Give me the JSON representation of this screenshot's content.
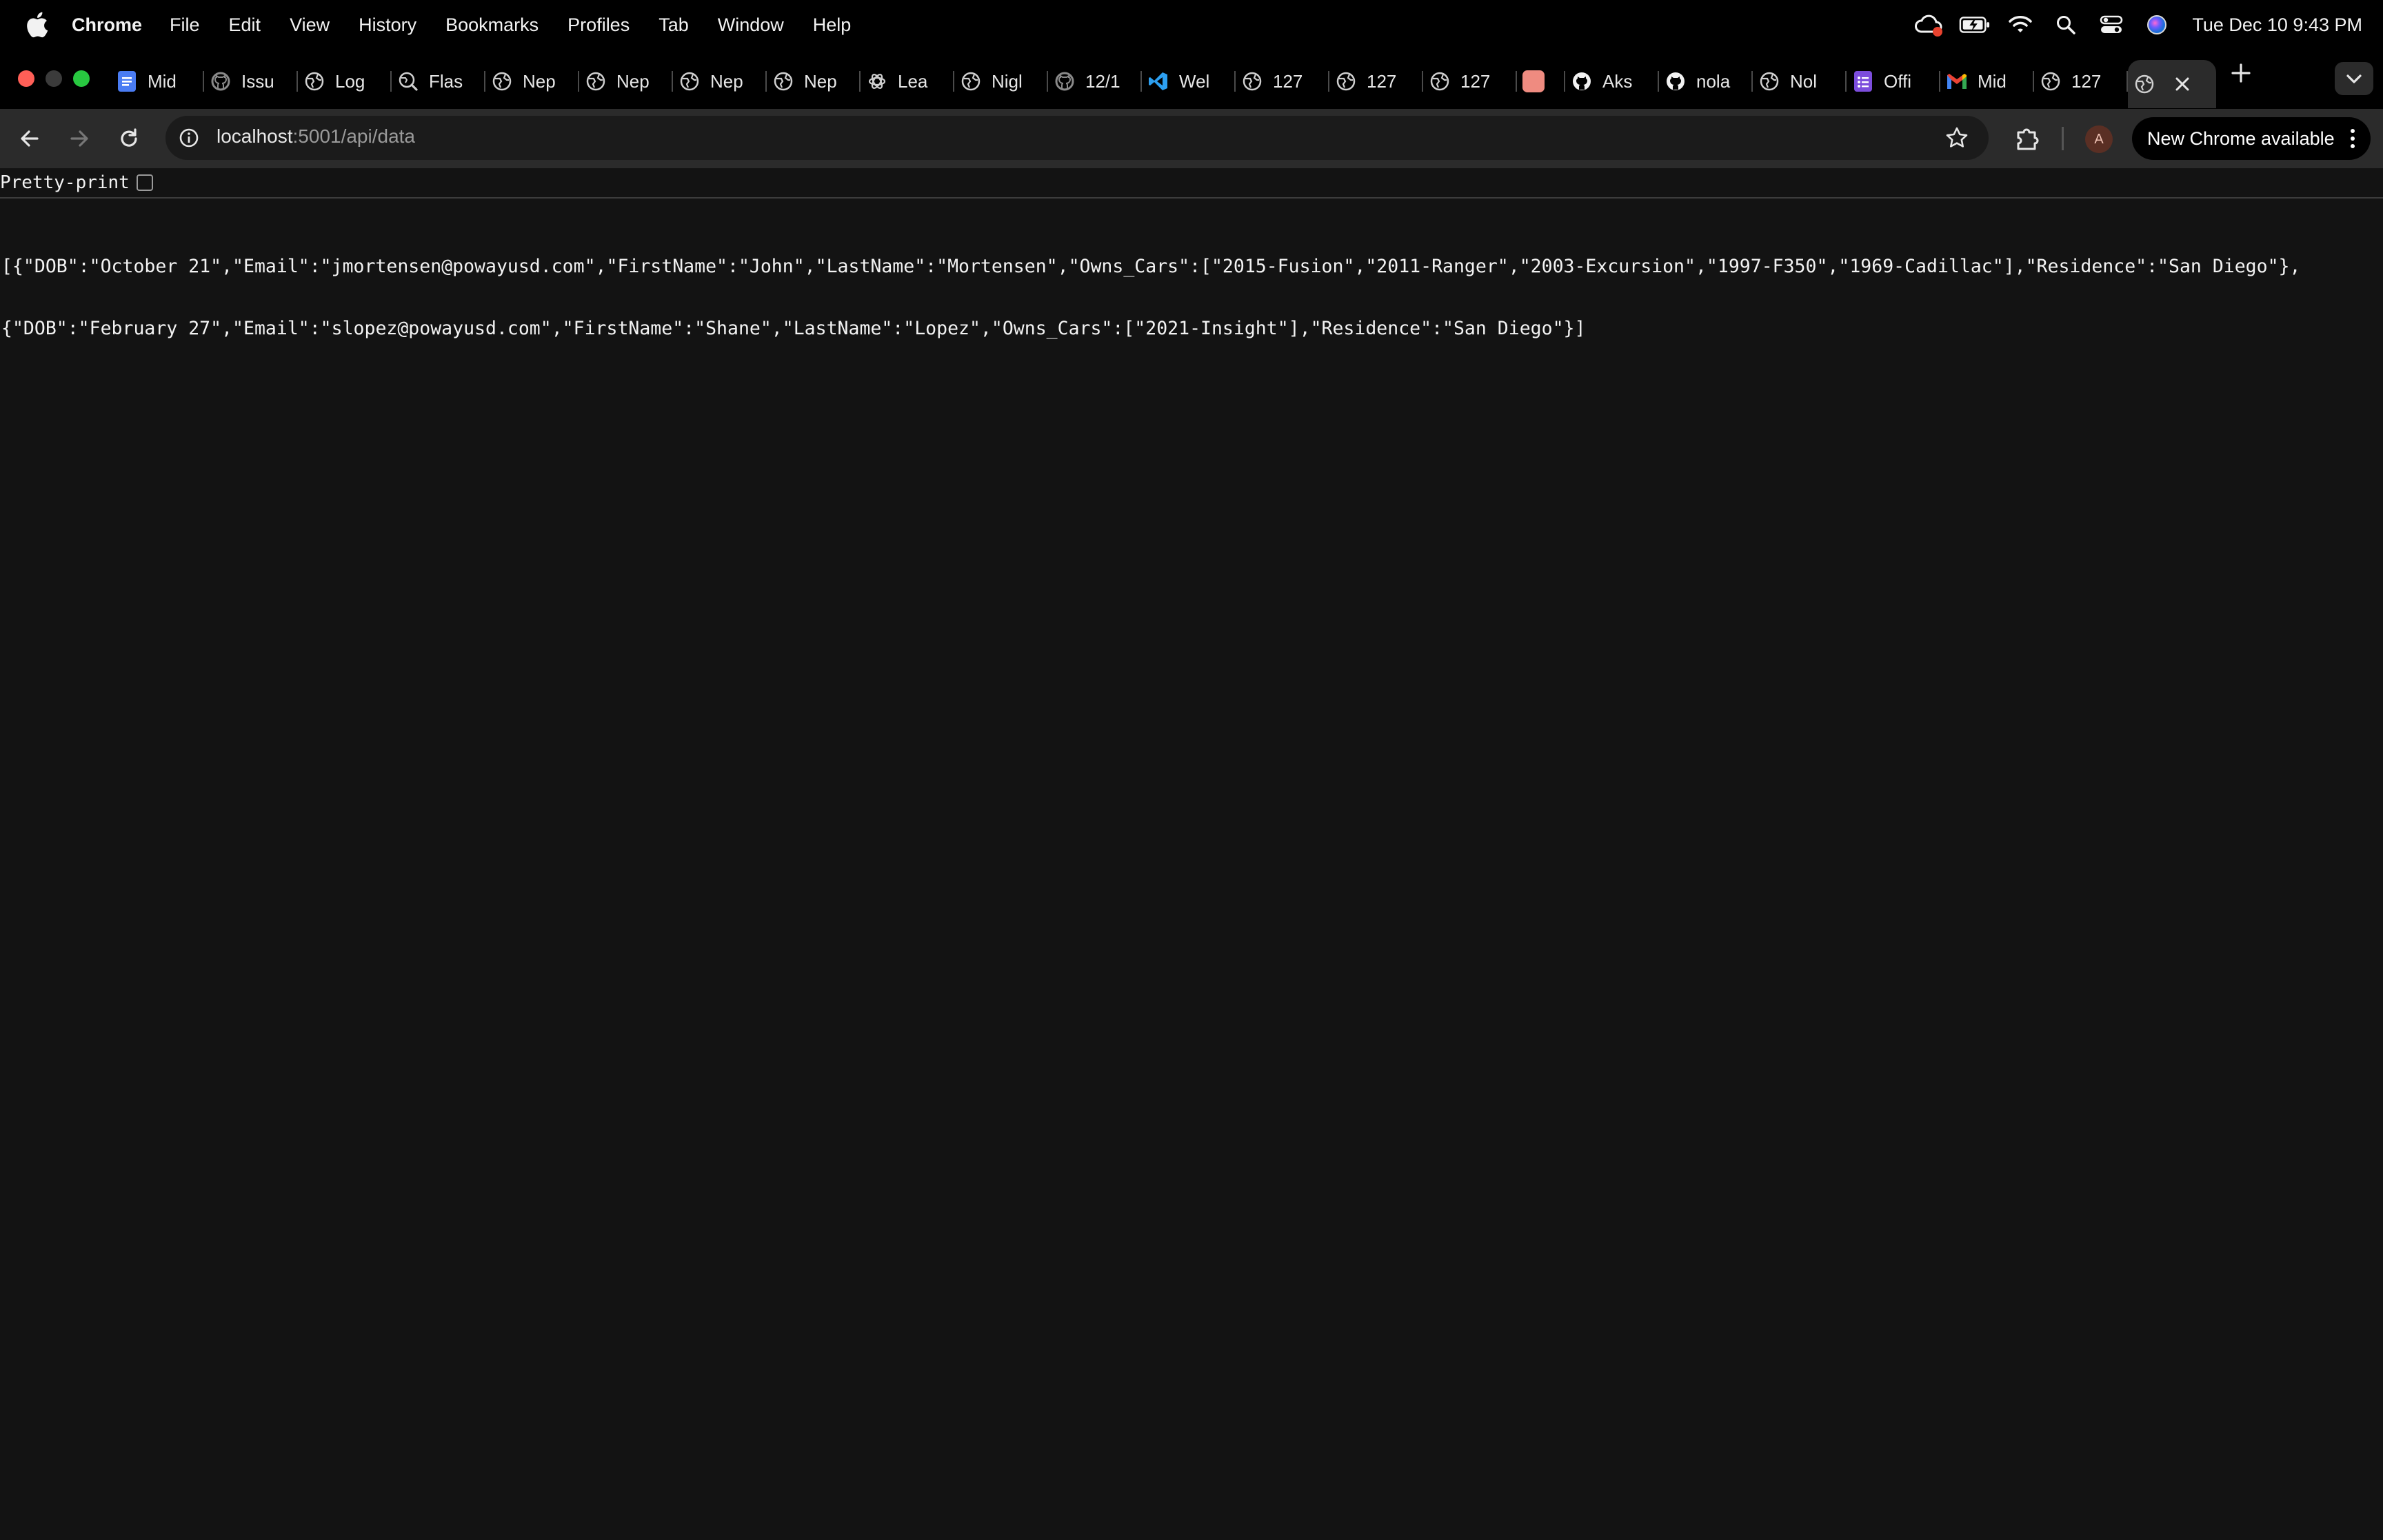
{
  "menubar": {
    "app_name": "Chrome",
    "items": [
      "File",
      "Edit",
      "View",
      "History",
      "Bookmarks",
      "Profiles",
      "Tab",
      "Window",
      "Help"
    ],
    "clock": "Tue Dec 10  9:43 PM"
  },
  "tabs": [
    {
      "title": "Mid",
      "icon": "docs-icon"
    },
    {
      "title": "Issu",
      "icon": "github-icon"
    },
    {
      "title": "Log",
      "icon": "globe-icon"
    },
    {
      "title": "Flas",
      "icon": "globe-search-icon"
    },
    {
      "title": "Nep",
      "icon": "globe-icon"
    },
    {
      "title": "Nep",
      "icon": "globe-icon"
    },
    {
      "title": "Nep",
      "icon": "globe-icon"
    },
    {
      "title": "Nep",
      "icon": "globe-icon"
    },
    {
      "title": "Lea",
      "icon": "openai-icon"
    },
    {
      "title": "Nigl",
      "icon": "globe-icon"
    },
    {
      "title": "12/1",
      "icon": "github-icon"
    },
    {
      "title": "Wel",
      "icon": "vscode-icon"
    },
    {
      "title": "127",
      "icon": "globe-icon"
    },
    {
      "title": "127",
      "icon": "globe-icon"
    },
    {
      "title": "127",
      "icon": "globe-icon"
    },
    {
      "title": "",
      "icon": "pink-square-icon"
    },
    {
      "title": "Aks",
      "icon": "github-icon"
    },
    {
      "title": "nola",
      "icon": "github-icon"
    },
    {
      "title": "Nol",
      "icon": "globe-icon"
    },
    {
      "title": "Offi",
      "icon": "forms-icon"
    },
    {
      "title": "Mid",
      "icon": "gmail-icon"
    },
    {
      "title": "127",
      "icon": "globe-icon"
    }
  ],
  "toolbar": {
    "url_host": "localhost",
    "url_path": ":5001/api/data",
    "update_label": "New Chrome available",
    "avatar_letter": "A"
  },
  "content": {
    "pretty_print_label": "Pretty-print",
    "json_line_1": "[{\"DOB\":\"October 21\",\"Email\":\"jmortensen@powayusd.com\",\"FirstName\":\"John\",\"LastName\":\"Mortensen\",\"Owns_Cars\":[\"2015-Fusion\",\"2011-Ranger\",\"2003-Excursion\",\"1997-F350\",\"1969-Cadillac\"],\"Residence\":\"San Diego\"},",
    "json_line_2": "{\"DOB\":\"February 27\",\"Email\":\"slopez@powayusd.com\",\"FirstName\":\"Shane\",\"LastName\":\"Lopez\",\"Owns_Cars\":[\"2021-Insight\"],\"Residence\":\"San Diego\"}]"
  },
  "colors": {
    "menubar_bg": "#000000",
    "toolbar_bg": "#2b2b2b",
    "page_bg": "#131313",
    "traffic_red": "#ff5f57",
    "traffic_green": "#28c840"
  }
}
